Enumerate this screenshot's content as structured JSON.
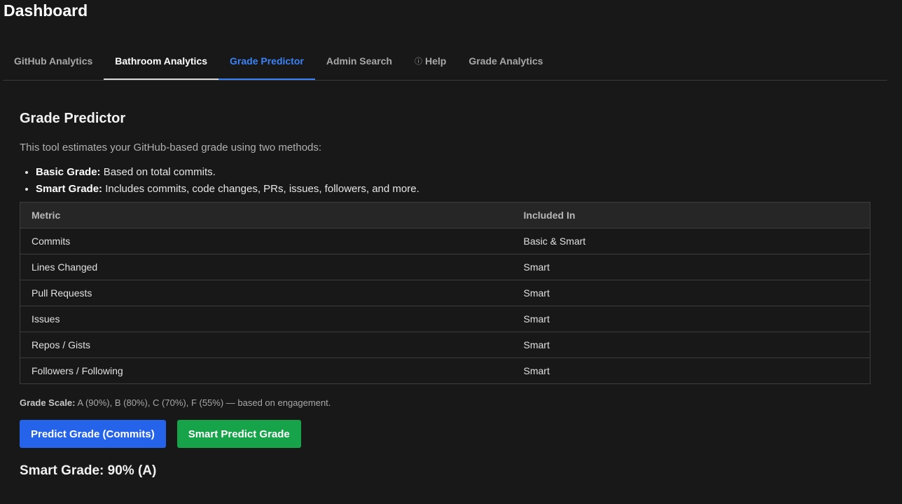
{
  "header": {
    "title": "Dashboard"
  },
  "tabs": [
    {
      "label": "GitHub Analytics",
      "icon": "",
      "state": "normal"
    },
    {
      "label": "Bathroom Analytics",
      "icon": "",
      "state": "hovered"
    },
    {
      "label": "Grade Predictor",
      "icon": "",
      "state": "active"
    },
    {
      "label": "Admin Search",
      "icon": "",
      "state": "normal"
    },
    {
      "label": "Help",
      "icon": "ⓘ",
      "state": "normal"
    },
    {
      "label": "Grade Analytics",
      "icon": "",
      "state": "normal"
    }
  ],
  "main": {
    "title": "Grade Predictor",
    "intro": "This tool estimates your GitHub-based grade using two methods:",
    "methods": [
      {
        "name": "Basic Grade:",
        "desc": " Based on total commits."
      },
      {
        "name": "Smart Grade:",
        "desc": " Includes commits, code changes, PRs, issues, followers, and more."
      }
    ],
    "table": {
      "headers": [
        "Metric",
        "Included In"
      ],
      "rows": [
        [
          "Commits",
          "Basic & Smart"
        ],
        [
          "Lines Changed",
          "Smart"
        ],
        [
          "Pull Requests",
          "Smart"
        ],
        [
          "Issues",
          "Smart"
        ],
        [
          "Repos / Gists",
          "Smart"
        ],
        [
          "Followers / Following",
          "Smart"
        ]
      ]
    },
    "scale": {
      "label": "Grade Scale:",
      "text": " A (90%), B (80%), C (70%), F (55%) — based on engagement."
    },
    "buttons": {
      "predict_label": "Predict Grade (Commits)",
      "smart_label": "Smart Predict Grade"
    },
    "result": "Smart Grade: 90% (A)"
  },
  "colors": {
    "background": "#181818",
    "accent": "#3b82f6",
    "predict_button": "#2563eb",
    "smart_button": "#16a34a"
  }
}
